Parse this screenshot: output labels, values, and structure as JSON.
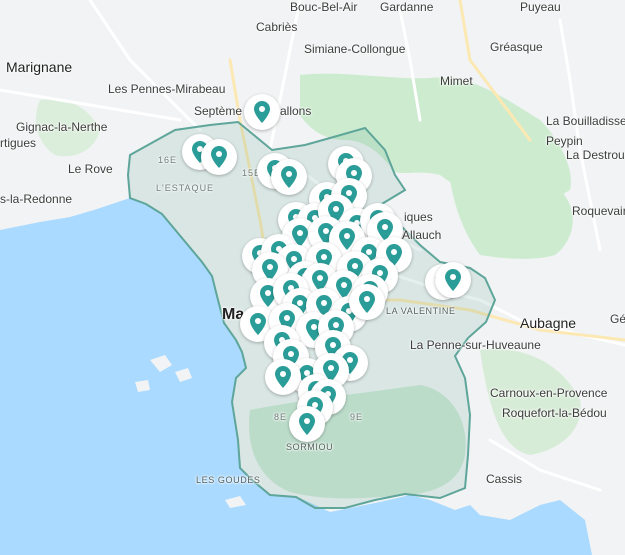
{
  "map": {
    "colors": {
      "water": "#aadaff",
      "land": "#f1f3f4",
      "park": "#cdeccf",
      "boundary": "#5ea59a",
      "marker": "#2a9d98"
    },
    "markers_icon": "map-pin-icon",
    "labels": {
      "bouc_bel_air": "Bouc-Bel-Air",
      "gardanne": "Gardanne",
      "puyeau": "Puyeau",
      "cabries": "Cabriès",
      "simiane": "Simiane-Collongue",
      "greasque": "Gréasque",
      "marignane": "Marignane",
      "pennes": "Les Pennes-Mirabeau",
      "mimet": "Mimet",
      "septemes_a": "Septème",
      "septemes_b": "allons",
      "gignac": "Gignac-la-Nerthe",
      "martigues": "rtigues",
      "bouilladisse": "La Bouilladisse",
      "peypin": "Peypin",
      "destrousse": "La Destrous",
      "rove": "Le Rove",
      "redonne": "s-la-Redonne",
      "roquevaire": "Roquevair",
      "allauch": "Allauch",
      "iques": "iques",
      "marseille": "Ma",
      "aubagne": "Aubagne",
      "ge": "Gé",
      "penne": "La Penne-sur-Huveaune",
      "carnoux": "Carnoux-en-Provence",
      "roquefort": "Roquefort-la-Bédou",
      "cassis": "Cassis",
      "estaque": "L'ESTAQUE",
      "d16": "16E",
      "d15": "15E",
      "d8": "8E",
      "d9": "9E",
      "valentine": "LA VALENTINE",
      "sormiou": "SORMIOU",
      "goudes": "LES GOUDES"
    }
  }
}
